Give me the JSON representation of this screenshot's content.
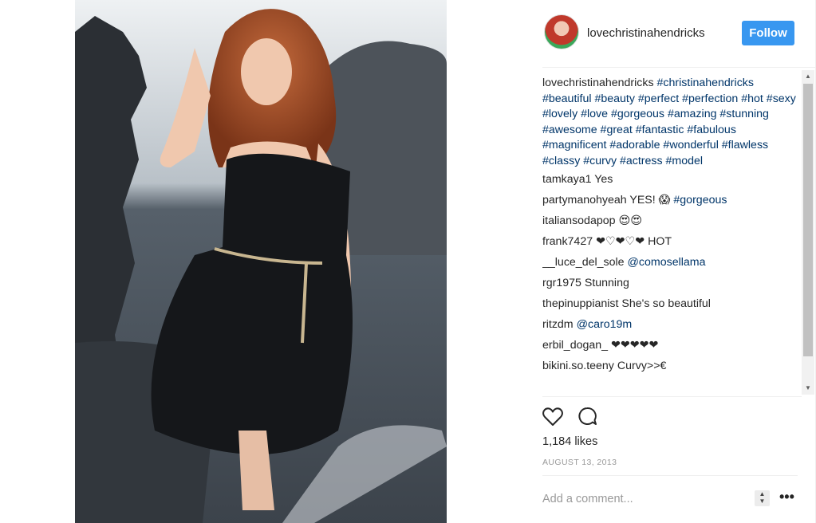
{
  "post": {
    "username": "lovechristinahendricks",
    "follow_label": "Follow",
    "caption": {
      "username": "lovechristinahendricks",
      "hashtags": "#christinahendricks #beautiful #beauty #perfect #perfection #hot #sexy #lovely #love #gorgeous #amazing #stunning #awesome #great #fantastic #fabulous #magnificent #adorable #wonderful #flawless #classy #curvy #actress #model"
    },
    "comments": [
      {
        "user": "tamkaya1",
        "text": "Yes",
        "mention": ""
      },
      {
        "user": "partymanohyeah",
        "text": "YES! 😱",
        "mention": "#gorgeous"
      },
      {
        "user": "italiansodapop",
        "text": "😍😍",
        "mention": ""
      },
      {
        "user": "frank7427",
        "text": "❤♡❤♡❤ HOT",
        "mention": ""
      },
      {
        "user": "__luce_del_sole",
        "text": "",
        "mention": "@comosellama"
      },
      {
        "user": "rgr1975",
        "text": "Stunning",
        "mention": ""
      },
      {
        "user": "thepinuppianist",
        "text": "She's so beautiful",
        "mention": ""
      },
      {
        "user": "ritzdm",
        "text": "",
        "mention": "@caro19m"
      },
      {
        "user": "erbil_dogan_",
        "text": "❤❤❤❤❤",
        "mention": ""
      },
      {
        "user": "bikini.so.teeny",
        "text": "Curvy>>€",
        "mention": ""
      }
    ],
    "likes_label": "1,184 likes",
    "date_label": "AUGUST 13, 2013",
    "comment_placeholder": "Add a comment...",
    "more_label": "•••"
  },
  "icons": {
    "like": "heart-icon",
    "comment": "speech-bubble-icon",
    "scroll_up": "arrow-up-icon",
    "scroll_down": "arrow-down-icon"
  },
  "colors": {
    "accent": "#3897f0",
    "link": "#003569",
    "muted": "#999999",
    "text": "#262626"
  }
}
